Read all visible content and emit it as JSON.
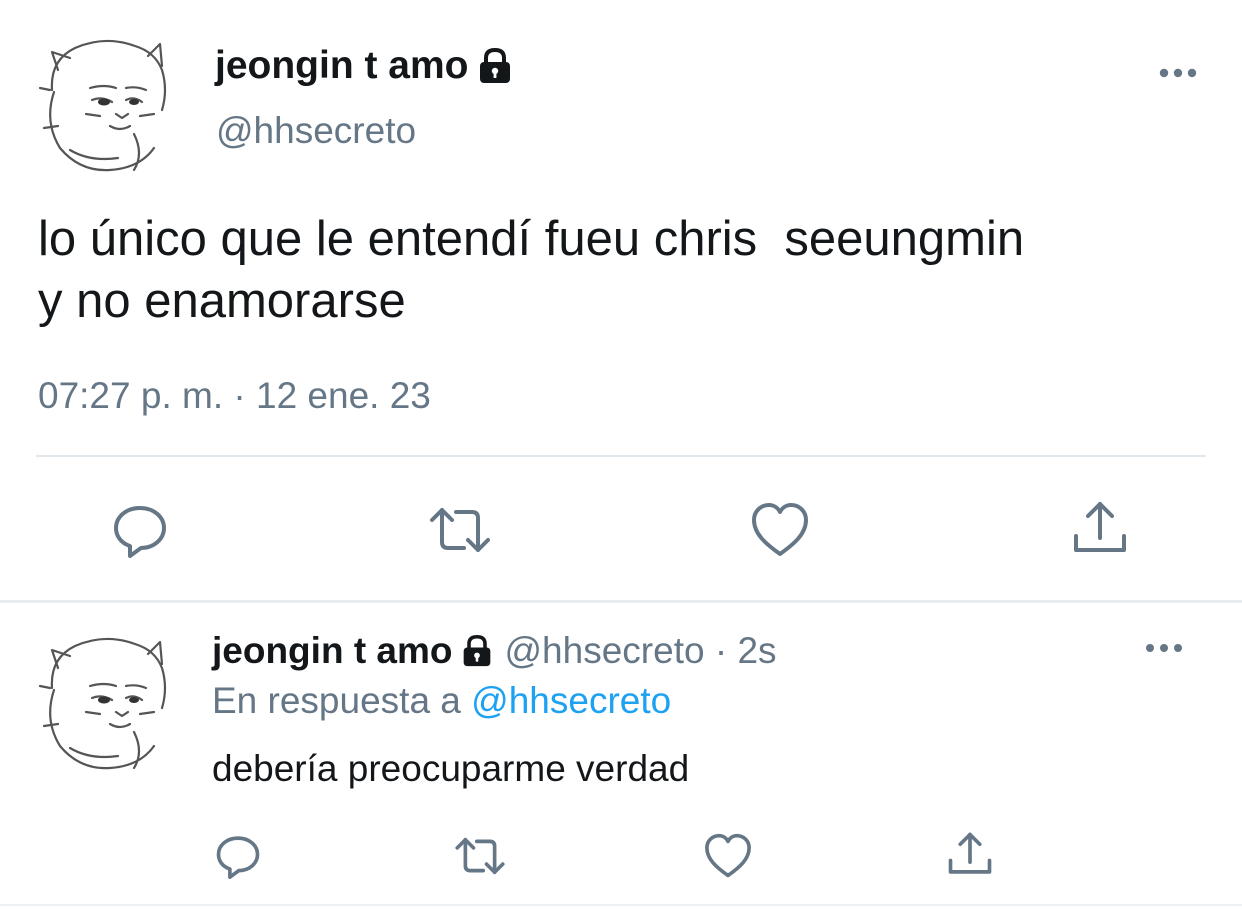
{
  "main_tweet": {
    "display_name": "jeongin t amo",
    "handle": "@hhsecreto",
    "text": "lo único que le entendí fueu chris  seeungmin\ny no enamorarse",
    "timestamp": "07:27 p. m. · 12 ene. 23",
    "icons": {
      "verified_lock": "lock-icon",
      "more": "more-horizontal-icon",
      "reply": "reply-icon",
      "retweet": "retweet-icon",
      "like": "heart-icon",
      "share": "share-icon"
    }
  },
  "reply_tweet": {
    "display_name": "jeongin t amo",
    "handle": "@hhsecreto",
    "separator": " · ",
    "age": "2s",
    "reply_context_prefix": "En respuesta a ",
    "reply_context_handle": "@hhsecreto",
    "text": "debería preocuparme verdad"
  },
  "colors": {
    "text_primary": "#14171a",
    "text_muted": "#657786",
    "link": "#1da1f2",
    "divider": "#e1e8ed"
  }
}
